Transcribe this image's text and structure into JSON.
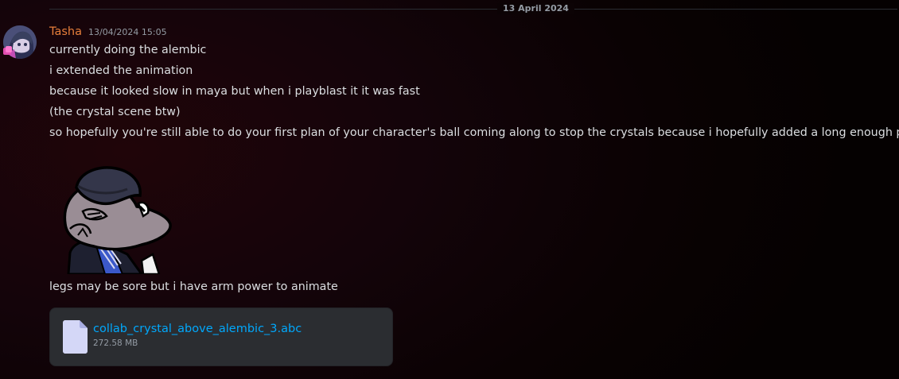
{
  "date_divider": {
    "label": "13 April 2024"
  },
  "message": {
    "author": {
      "name": "Tasha",
      "name_color": "#e67e3b",
      "avatar_icon": "user-avatar"
    },
    "timestamp": "13/04/2024 15:05",
    "lines": [
      "currently doing the alembic",
      "i extended the animation",
      "because it looked slow in maya but when i playblast it it was fast",
      "(the crystal scene btw)",
      "so hopefully you're still able to do your first plan of your character's ball coming along to stop the crystals because i hopefully added a long enough pause"
    ],
    "sticker": {
      "icon": "cartoon-character-sticker"
    },
    "after_sticker_line": "legs may be sore but i have arm power to animate",
    "attachment": {
      "file_name": "collab_crystal_above_alembic_3.abc",
      "file_size": "272.58 MB",
      "icon": "file-icon"
    }
  },
  "colors": {
    "link": "#00a8fc",
    "text": "#dbdee1",
    "muted": "#949ba4",
    "attachment_bg": "#2b2d31"
  }
}
